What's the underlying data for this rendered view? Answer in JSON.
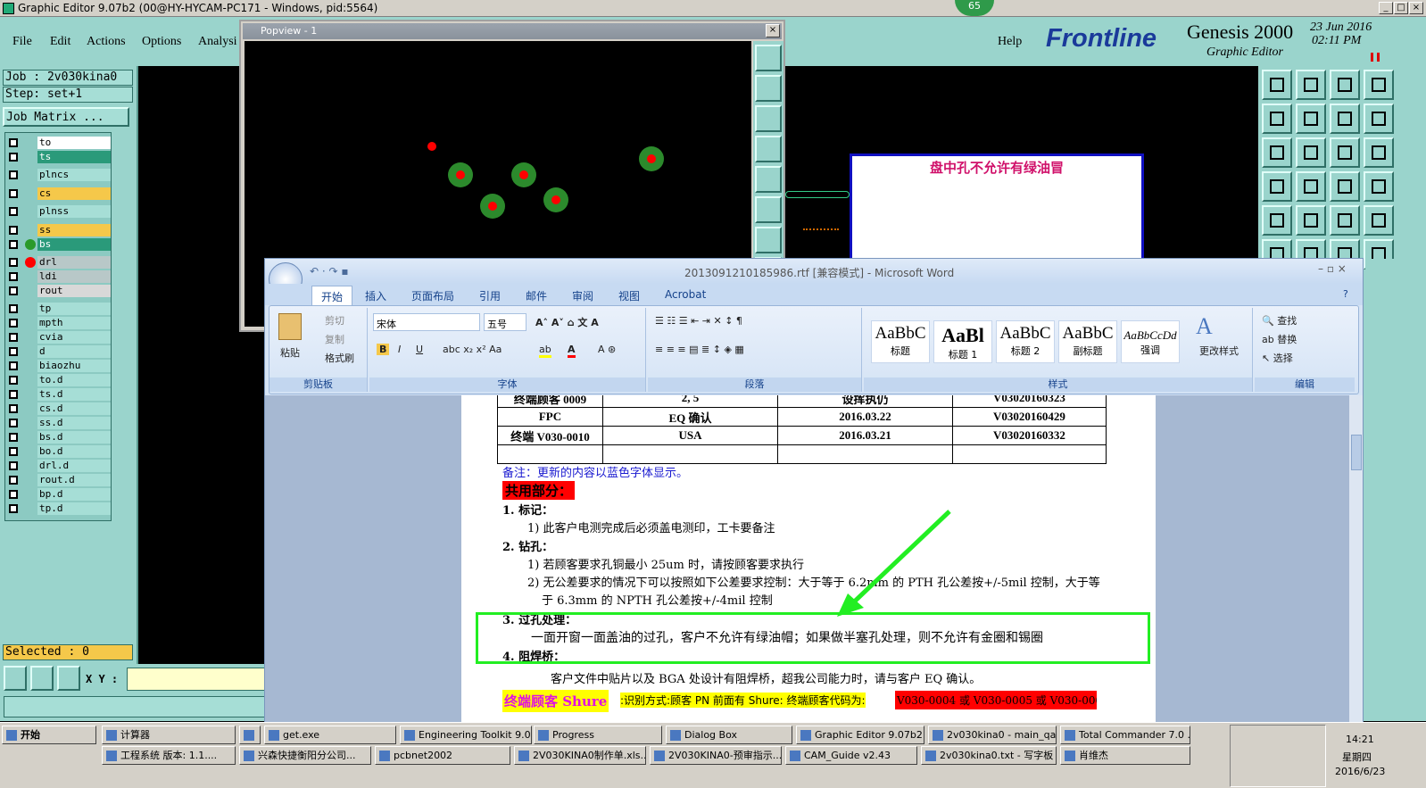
{
  "genesis": {
    "title": "Graphic Editor 9.07b2 (00@HY-HYCAM-PC171 - Windows, pid:5564)",
    "badge": "65",
    "menu": [
      "File",
      "Edit",
      "Actions",
      "Options",
      "Analysi"
    ],
    "help": "Help",
    "brand": "Frontline",
    "product": "Genesis 2000",
    "subtitle": "Graphic Editor",
    "date": "23 Jun 2016",
    "time": "02:11 PM",
    "job": "Job : 2v030kina0",
    "step": "Step: set+1",
    "job_matrix": "Job Matrix ...",
    "selected": "Selected : 0",
    "xy_label": "X Y :",
    "layers": [
      "to",
      "ts",
      "plncs",
      "cs",
      "plnss",
      "ss",
      "bs",
      "drl",
      "ldi",
      "rout",
      "tp",
      "mpth",
      "cvia",
      "d",
      "biaozhu",
      "to.d",
      "ts.d",
      "cs.d",
      "ss.d",
      "bs.d",
      "bo.d",
      "drl.d",
      "rout.d",
      "bp.d",
      "tp.d"
    ]
  },
  "popview": {
    "title": "Popview - 1"
  },
  "annotation": {
    "text": "盘中孔不允许有绿油冒"
  },
  "word": {
    "title": "2013091210185986.rtf [兼容模式] - Microsoft Word",
    "tabs": [
      "开始",
      "插入",
      "页面布局",
      "引用",
      "邮件",
      "审阅",
      "视图",
      "Acrobat"
    ],
    "clipboard": {
      "paste": "粘贴",
      "cut": "剪切",
      "copy": "复制",
      "format_painter": "格式刷",
      "label": "剪贴板"
    },
    "font": {
      "name": "宋体",
      "size": "五号",
      "label": "字体"
    },
    "paragraph_label": "段落",
    "styles": [
      {
        "preview": "AaBbC",
        "name": "标题"
      },
      {
        "preview": "AaBl",
        "name": "标题 1"
      },
      {
        "preview": "AaBbC",
        "name": "标题 2"
      },
      {
        "preview": "AaBbC",
        "name": "副标题"
      },
      {
        "preview": "AaBbCcDd",
        "name": "强调"
      }
    ],
    "change_styles": "更改样式",
    "styles_label": "样式",
    "editing": {
      "find": "查找",
      "replace": "替换",
      "select": "选择",
      "label": "编辑"
    },
    "table_rows": [
      [
        "终端顾客 0009",
        "2, 5",
        "设挥执仍",
        "V03020160323"
      ],
      [
        "FPC",
        "EQ 确认",
        "2016.03.22",
        "V03020160429"
      ],
      [
        "终端 V030-0010",
        "USA",
        "2016.03.21",
        "V03020160332"
      ],
      [
        "",
        "",
        "",
        ""
      ]
    ],
    "doc_lines": {
      "note": "备注：更新的内容以蓝色字体显示。",
      "shared": "共用部分：",
      "h1": "1.   标记：",
      "l1": "1)  此客户电测完成后必须盖电测印，工卡要备注",
      "h2": "2.   钻孔：",
      "l2a": "1)  若顾客要求孔铜最小 25um 时，请按顾客要求执行",
      "l2b": "2)  无公差要求的情况下可以按照如下公差要求控制：大于等于 6.2mm 的 PTH 孔公差按+/-5mil 控制，大于等",
      "l2c": "于 6.3mm 的 NPTH 孔公差按+/-4mil 控制",
      "h3": "3. 过孔处理：",
      "l3": "一面开窗一面盖油的过孔，客户不允许有绿油帽；如果做半塞孔处理，则不允许有金圈和锡圈",
      "h4": "4. 阻焊桥：",
      "l4": "客户文件中贴片以及 BGA 处设计有阻焊桥，超我公司能力时，请与客户 EQ 确认。",
      "customer_hl": "终端顾客 Shure",
      "customer_rest": ":识别方式:顾客 PN 前面有 Shure: 终端顾客代码为:",
      "customer_codes": "V030-0004 或 V030-0005 或 V030-0008"
    }
  },
  "taskbar": {
    "start": "开始",
    "row1": [
      "计算器",
      "",
      "get.exe",
      "Engineering Toolkit 9.0...",
      "Progress",
      "Dialog Box",
      "Graphic Editor 9.07b2 (...",
      "2v030kina0 - main_qa",
      "Total Commander 7.0 ..."
    ],
    "row2": [
      "工程系统  版本: 1.1....",
      "兴森快捷衡阳分公司...",
      "pcbnet2002",
      "2V030KINA0制作单.xls...",
      "2V030KINA0-预审指示...",
      "CAM_Guide v2.43",
      "2v030kina0.txt - 写字板",
      "肖维杰"
    ],
    "clock": "14:21",
    "weekday": "星期四",
    "date": "2016/6/23"
  },
  "colors": {
    "panel": "#9ad4cc",
    "arrow": "#22ee22",
    "highlight_red": "#ff0000",
    "highlight_yellow": "#ffff00"
  }
}
